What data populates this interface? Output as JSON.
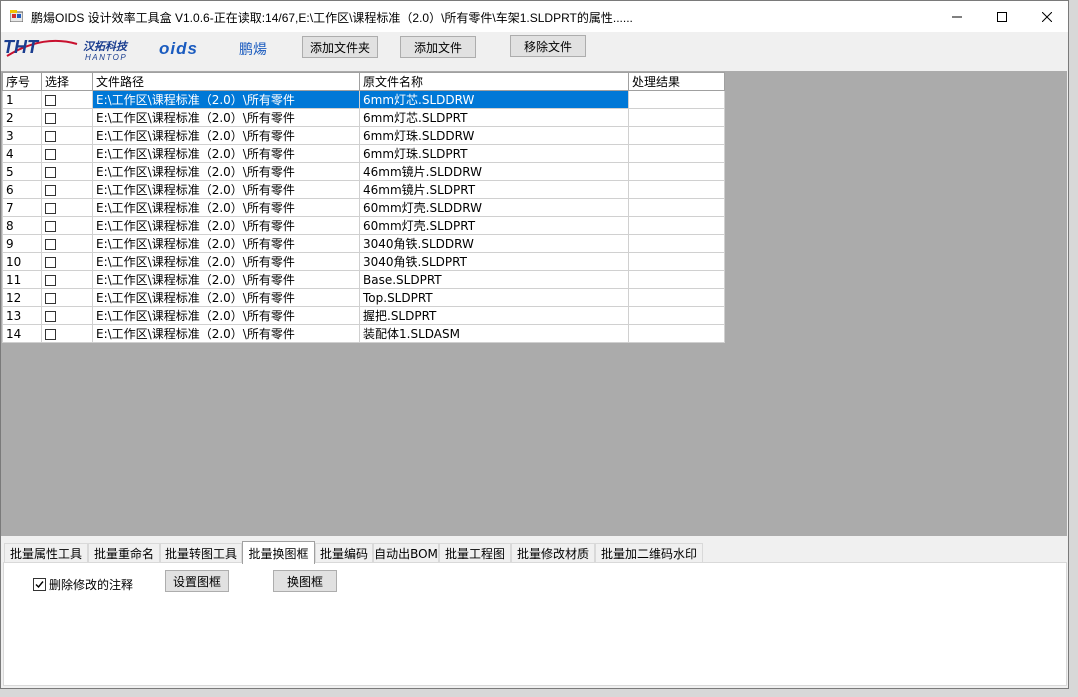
{
  "window": {
    "title": "鹏煬OIDS 设计效率工具盒 V1.0.6-正在读取:14/67,E:\\工作区\\课程标准（2.0）\\所有零件\\车架1.SLDPRT的属性......"
  },
  "branding": {
    "tht_text": "THT",
    "tht_cn": "汉拓科技",
    "tht_en": "HANTOP",
    "oids_text": "oids",
    "oids_cn": "鹏煬"
  },
  "toolbar": {
    "add_folder": "添加文件夹",
    "add_file": "添加文件",
    "remove_file": "移除文件"
  },
  "grid": {
    "headers": [
      "序号",
      "选择",
      "文件路径",
      "原文件名称",
      "处理结果"
    ],
    "rows": [
      {
        "no": "1",
        "path": "E:\\工作区\\课程标准（2.0）\\所有零件",
        "name": "6mm灯芯.SLDDRW",
        "result": ""
      },
      {
        "no": "2",
        "path": "E:\\工作区\\课程标准（2.0）\\所有零件",
        "name": "6mm灯芯.SLDPRT",
        "result": ""
      },
      {
        "no": "3",
        "path": "E:\\工作区\\课程标准（2.0）\\所有零件",
        "name": "6mm灯珠.SLDDRW",
        "result": ""
      },
      {
        "no": "4",
        "path": "E:\\工作区\\课程标准（2.0）\\所有零件",
        "name": "6mm灯珠.SLDPRT",
        "result": ""
      },
      {
        "no": "5",
        "path": "E:\\工作区\\课程标准（2.0）\\所有零件",
        "name": "46mm镜片.SLDDRW",
        "result": ""
      },
      {
        "no": "6",
        "path": "E:\\工作区\\课程标准（2.0）\\所有零件",
        "name": "46mm镜片.SLDPRT",
        "result": ""
      },
      {
        "no": "7",
        "path": "E:\\工作区\\课程标准（2.0）\\所有零件",
        "name": "60mm灯壳.SLDDRW",
        "result": ""
      },
      {
        "no": "8",
        "path": "E:\\工作区\\课程标准（2.0）\\所有零件",
        "name": "60mm灯壳.SLDPRT",
        "result": ""
      },
      {
        "no": "9",
        "path": "E:\\工作区\\课程标准（2.0）\\所有零件",
        "name": "3040角铁.SLDDRW",
        "result": ""
      },
      {
        "no": "10",
        "path": "E:\\工作区\\课程标准（2.0）\\所有零件",
        "name": "3040角铁.SLDPRT",
        "result": ""
      },
      {
        "no": "11",
        "path": "E:\\工作区\\课程标准（2.0）\\所有零件",
        "name": "Base.SLDPRT",
        "result": ""
      },
      {
        "no": "12",
        "path": "E:\\工作区\\课程标准（2.0）\\所有零件",
        "name": "Top.SLDPRT",
        "result": ""
      },
      {
        "no": "13",
        "path": "E:\\工作区\\课程标准（2.0）\\所有零件",
        "name": "握把.SLDPRT",
        "result": ""
      },
      {
        "no": "14",
        "path": "E:\\工作区\\课程标准（2.0）\\所有零件",
        "name": "装配体1.SLDASM",
        "result": ""
      }
    ]
  },
  "tabs": [
    "批量属性工具",
    "批量重命名",
    "批量转图工具",
    "批量换图框",
    "批量编码",
    "自动出BOM",
    "批量工程图",
    "批量修改材质",
    "批量加二维码水印"
  ],
  "panel": {
    "delete_notes_label": "删除修改的注释",
    "set_frame_button": "设置图框",
    "swap_frame_button": "换图框"
  }
}
